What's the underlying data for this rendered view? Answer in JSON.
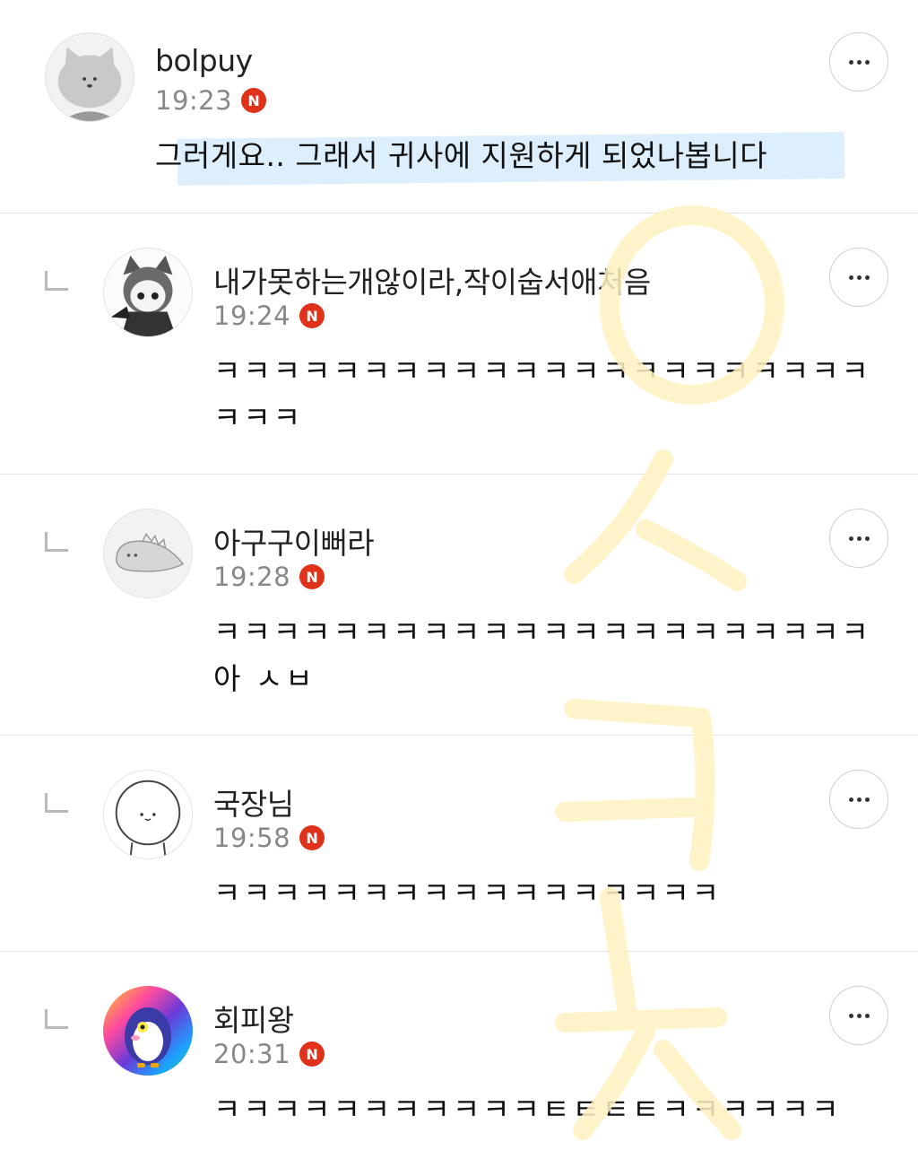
{
  "comments": [
    {
      "nickname": "bolpuy",
      "time": "19:23",
      "badge": "N",
      "text": "그러게요.. 그래서 귀사에 지원하게 되었나봅니다",
      "avatar": "cat-avatar-icon",
      "highlighted": true
    },
    {
      "nickname": "내가못하는개않이라,작이숩서애처음",
      "time": "19:24",
      "badge": "N",
      "text": "ㅋㅋㅋㅋㅋㅋㅋㅋㅋㅋㅋㅋㅋㅋㅋㅋㅋㅋㅋㅋㅋㅋ ㅋㅋㅋ",
      "avatar": "anime-girl-avatar-icon"
    },
    {
      "nickname": "아구구이뻐라",
      "time": "19:28",
      "badge": "N",
      "text": "ㅋㅋㅋㅋㅋㅋㅋㅋㅋㅋㅋㅋㅋㅋㅋㅋㅋㅋㅋㅋㅋㅋ 아 ㅅㅂ",
      "avatar": "dinosaur-avatar-icon"
    },
    {
      "nickname": "국장님",
      "time": "19:58",
      "badge": "N",
      "text": "ㅋㅋㅋㅋㅋㅋㅋㅋㅋㅋㅋㅋㅋㅋㅋㅋㅋ",
      "avatar": "round-face-avatar-icon"
    },
    {
      "nickname": "회피왕",
      "time": "20:31",
      "badge": "N",
      "text": "ㅋㅋㅋㅋㅋㅋㅋㅋㅋㅋㅋㅌㅌㅌㅌㅋㅋㅋㅋㅋㅋ",
      "avatar": "penguin-avatar-icon"
    }
  ],
  "watermark": {
    "text": "ㅇㅅㅋㅋ",
    "color": "#fff3c4"
  },
  "colors": {
    "badge": "#e0311b",
    "highlight": "#ddeefd"
  }
}
